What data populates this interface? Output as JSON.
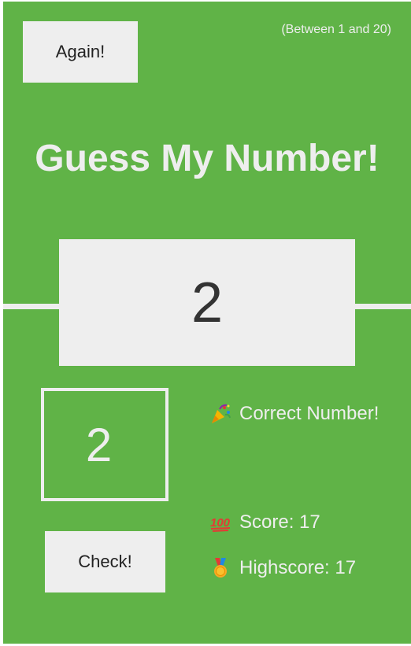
{
  "header": {
    "again_label": "Again!",
    "range_hint": "(Between 1 and 20)"
  },
  "title": "Guess My Number!",
  "secret_number": "2",
  "guess": {
    "value": "2"
  },
  "check_label": "Check!",
  "message": {
    "icon": "party-popper-icon",
    "text": "Correct Number!"
  },
  "score": {
    "icon": "hundred-points-icon",
    "text": "Score: 17"
  },
  "highscore": {
    "icon": "medal-icon",
    "text": "Highscore: 17"
  },
  "colors": {
    "background": "#60b347",
    "panel": "#eeeeee",
    "text_dark": "#333333"
  }
}
